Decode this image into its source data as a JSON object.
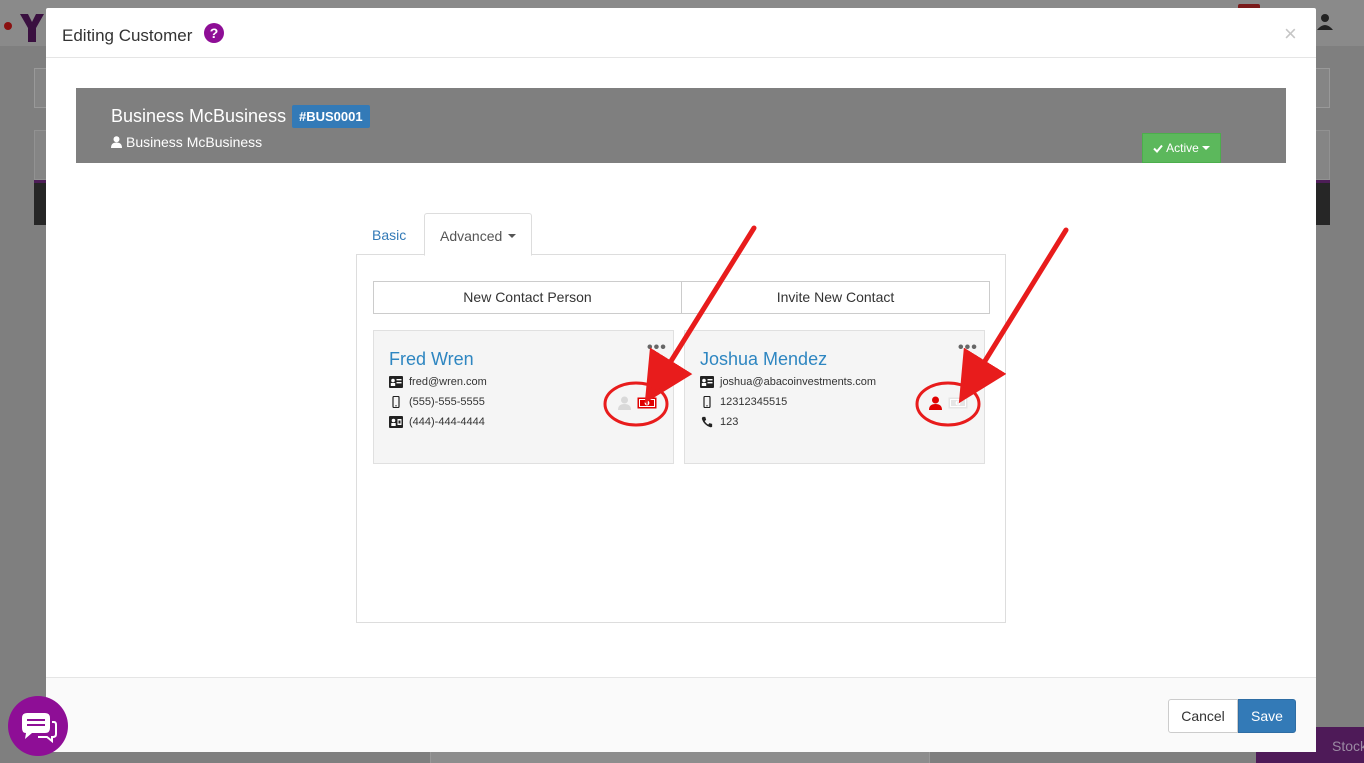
{
  "background": {
    "stock_label": "Stock"
  },
  "modal": {
    "title": "Editing Customer",
    "help_glyph": "?",
    "close_glyph": "×"
  },
  "banner": {
    "name": "Business McBusiness",
    "code": "#BUS0001",
    "contact": "Business McBusiness",
    "status": "Active"
  },
  "tabs": [
    {
      "label": "Basic",
      "active": false
    },
    {
      "label": "Advanced",
      "active": true
    }
  ],
  "actions": {
    "new_contact": "New Contact Person",
    "invite_contact": "Invite New Contact"
  },
  "contacts": [
    {
      "name": "Fred Wren",
      "email": "fred@wren.com",
      "mobile": "(555)-555-5555",
      "fax": "(444)-444-4444",
      "primary_contact": false,
      "billing_contact": true
    },
    {
      "name": "Joshua Mendez",
      "email": "joshua@abacoinvestments.com",
      "mobile": "12312345515",
      "phone": "123",
      "primary_contact": true,
      "billing_contact": false
    }
  ],
  "footer": {
    "cancel": "Cancel",
    "save": "Save"
  },
  "colors": {
    "accent_purple": "#8e0e96",
    "primary_blue": "#337ab7",
    "success_green": "#5cb85c",
    "contact_red": "#e00000",
    "annotation_red": "#e81c1c"
  },
  "icons": [
    "help-icon",
    "close-icon",
    "user-icon",
    "check-icon",
    "ellipsis-icon",
    "contact-card-icon",
    "mobile-phone-icon",
    "fax-card-icon",
    "phone-icon",
    "person-icon",
    "money-icon",
    "chat-icon"
  ]
}
